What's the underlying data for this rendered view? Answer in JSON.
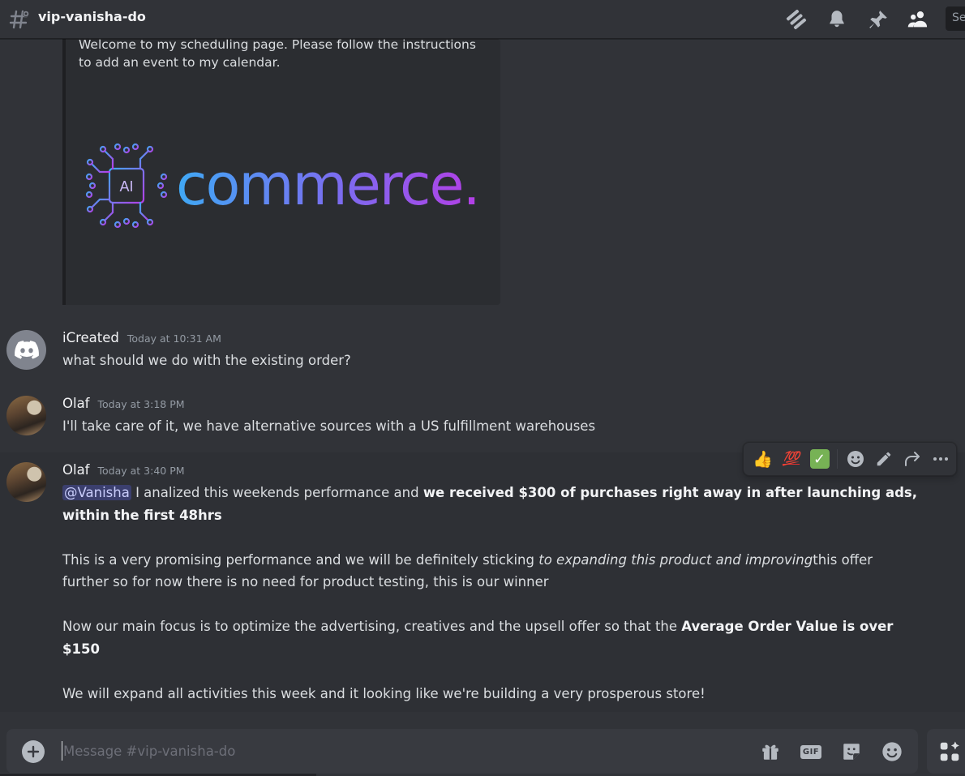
{
  "header": {
    "channel_name": "vip-vanisha-do",
    "search_stub": "Se"
  },
  "embed": {
    "description": "Welcome to my scheduling page. Please follow the instructions to add an event to my calendar.",
    "image": {
      "chip_label": "AI",
      "logo_word": "commerce."
    }
  },
  "messages": [
    {
      "username": "iCreated",
      "timestamp": "Today at 10:31 AM",
      "text": "what should we do with the existing order?"
    },
    {
      "username": "Olaf",
      "timestamp": "Today at 3:18 PM",
      "text": "I'll take care of it, we have alternative sources with a US fulfillment warehouses"
    },
    {
      "username": "Olaf",
      "timestamp": "Today at 3:40 PM",
      "p1_mention": "@Vanisha",
      "p1_text": " I analized this weekends performance and ",
      "p1_bold": "we received $300 of purchases right away in after launching ads, within the first 48hrs",
      "p2_text_a": "This is a very promising performance and we will be definitely sticking ",
      "p2_italic": "to expanding this product and improving",
      "p2_text_b": "this offer further so for now there is no need for product testing, this is our winner",
      "p3_text": "Now our main focus is to optimize the advertising, creatives and the upsell offer so that the ",
      "p3_bold": "Average Order Value is over $150",
      "p4_text": "We will expand all activities this week and it looking like we're building a very prosperous store!"
    }
  ],
  "toolbar": {
    "reaction_1": "👍",
    "reaction_2": "💯",
    "reaction_3": "✓"
  },
  "composer": {
    "placeholder": "Message #vip-vanisha-do",
    "gif_label": "GIF"
  },
  "colors": {
    "background": "#313338",
    "embed_bg": "#2b2d31",
    "mention_bg": "#3c4270",
    "logo_gradient_start": "#3fa9f5",
    "logo_gradient_end": "#b43ee6"
  }
}
